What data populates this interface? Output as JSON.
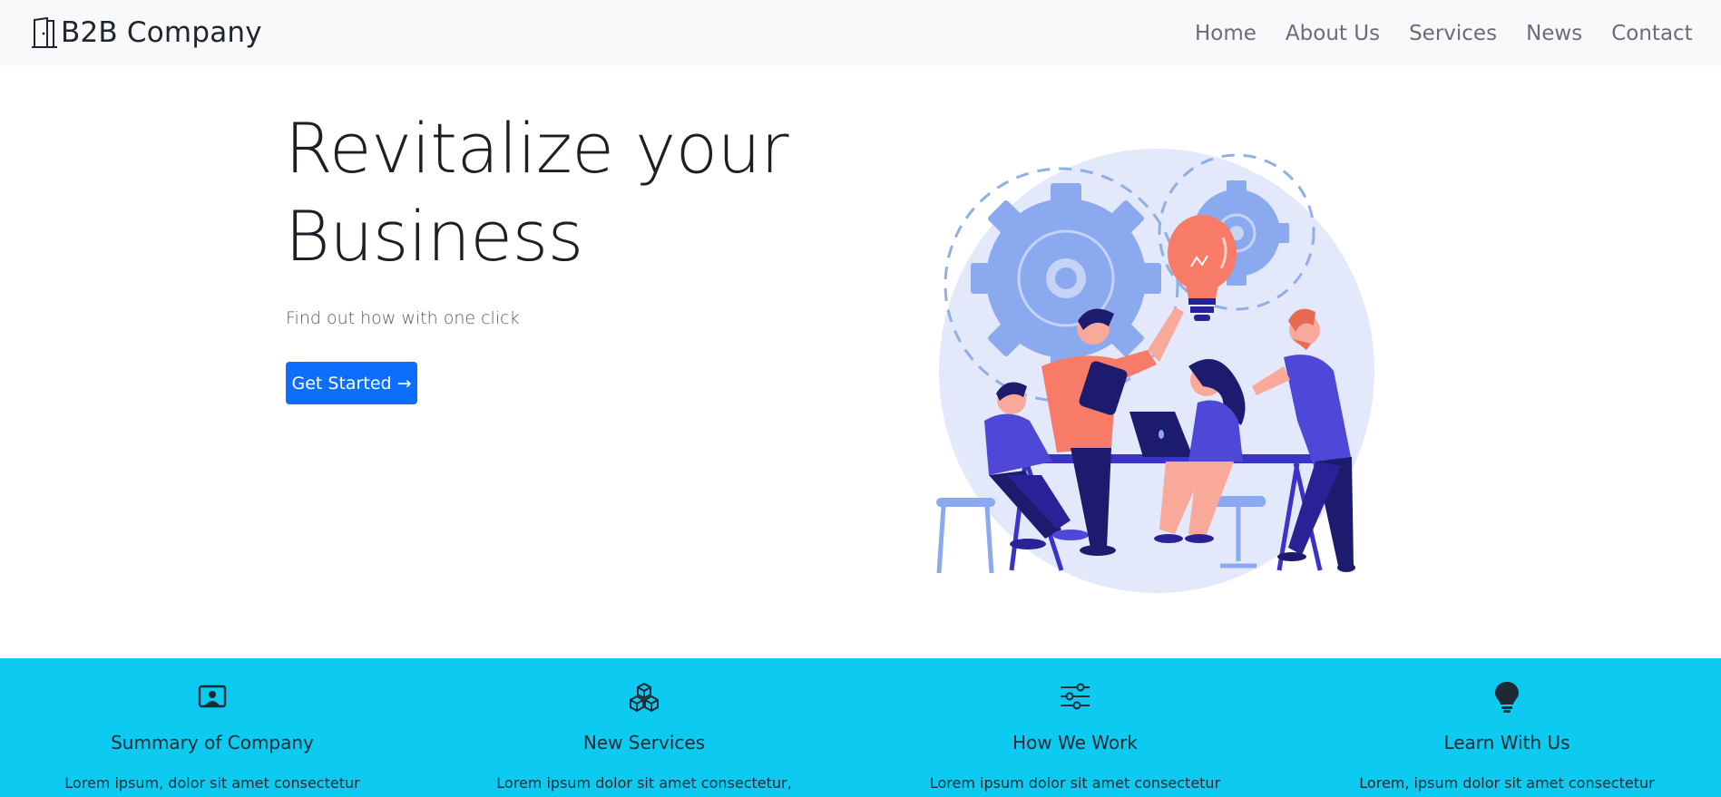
{
  "brand": {
    "name": "B2B Company",
    "icon": "building-door-icon"
  },
  "nav": {
    "items": [
      {
        "label": "Home"
      },
      {
        "label": "About Us"
      },
      {
        "label": "Services"
      },
      {
        "label": "News"
      },
      {
        "label": "Contact"
      }
    ]
  },
  "hero": {
    "title_line1": "Revitalize your",
    "title_line2": "Business",
    "subtitle": "Find out how with one click",
    "cta_label": "Get Started",
    "cta_arrow": "→",
    "illustration": "team-meeting-illustration"
  },
  "features": [
    {
      "icon": "person-video-icon",
      "title": "Summary of Company",
      "text": "Lorem ipsum, dolor sit amet consectetur"
    },
    {
      "icon": "boxes-icon",
      "title": "New Services",
      "text": "Lorem ipsum dolor sit amet consectetur,"
    },
    {
      "icon": "sliders-icon",
      "title": "How We Work",
      "text": "Lorem ipsum dolor sit amet consectetur"
    },
    {
      "icon": "lightbulb-icon",
      "title": "Learn With Us",
      "text": "Lorem, ipsum dolor sit amet consectetur"
    }
  ],
  "colors": {
    "navbar_bg": "#f8f9fa",
    "primary": "#0d6efd",
    "features_bg": "#0dcaf0",
    "illustration_accent": "#f87b67",
    "illustration_navy": "#2b2196"
  }
}
